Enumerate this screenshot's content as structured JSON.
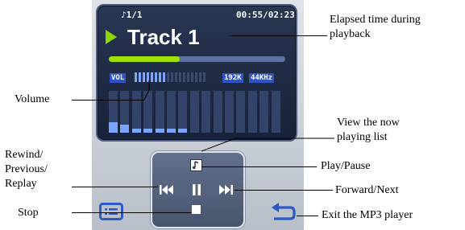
{
  "player": {
    "track_count": "♪1/1",
    "elapsed_time": "00:55/02:23",
    "track_title": "Track 1",
    "progress_fraction": 0.4,
    "volume_label": "VOL",
    "volume_level_fraction": 0.43,
    "bitrate": "192K",
    "sample_rate": "44KHz",
    "equalizer_levels": [
      0.25,
      0.2,
      0.1,
      0.1,
      0.1,
      0.1,
      0.1,
      0,
      0,
      0,
      0,
      0,
      0,
      0,
      0
    ],
    "colors": {
      "screen": "#1f2a44",
      "accent_green": "#9fe000",
      "progress_track": "#5c72a3",
      "volume_active": "#7aa6ff",
      "badge_blue": "#2e52c8",
      "icon_blue": "#2b5ac8"
    }
  },
  "controls": {
    "icons": [
      "playlist-icon",
      "rewind-previous-icon",
      "play-pause-icon",
      "forward-next-icon",
      "stop-icon",
      "menu-icon",
      "back-exit-icon"
    ]
  },
  "annotations": {
    "elapsed": [
      "Elapsed time during",
      "playback"
    ],
    "volume": "Volume",
    "playlist": [
      "View the now",
      "playing list"
    ],
    "rewind": [
      "Rewind/",
      "Previous/",
      "Replay"
    ],
    "play_pause": "Play/Pause",
    "forward": "Forward/Next",
    "stop": "Stop",
    "exit": "Exit the MP3 player"
  }
}
